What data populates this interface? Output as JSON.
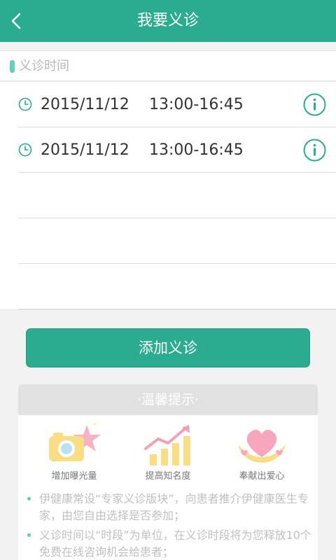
{
  "header": {
    "title": "我要义诊"
  },
  "section": {
    "title": "义诊时间"
  },
  "slots": [
    {
      "date": "2015/11/12",
      "time": "13:00-16:45"
    },
    {
      "date": "2015/11/12",
      "time": "13:00-16:45"
    }
  ],
  "add_button": {
    "label": "添加义诊"
  },
  "tips": {
    "title": "·温馨提示·",
    "items": [
      {
        "icon": "camera-star-icon",
        "label": "增加曝光量"
      },
      {
        "icon": "growth-chart-icon",
        "label": "提高知名度"
      },
      {
        "icon": "heart-hands-icon",
        "label": "奉献出爱心"
      }
    ],
    "notes": [
      "伊健康常设“专家义诊版块”，向患者推介伊健康医生专家，由您自由选择是否参加；",
      "义诊时间以“时段”为单位，在义诊时段将为您释放10个免费在线咨询机会给患者；"
    ]
  },
  "colors": {
    "primary": "#2bab8f",
    "accent": "#62d0ba",
    "muted": "#c0c0c0"
  }
}
